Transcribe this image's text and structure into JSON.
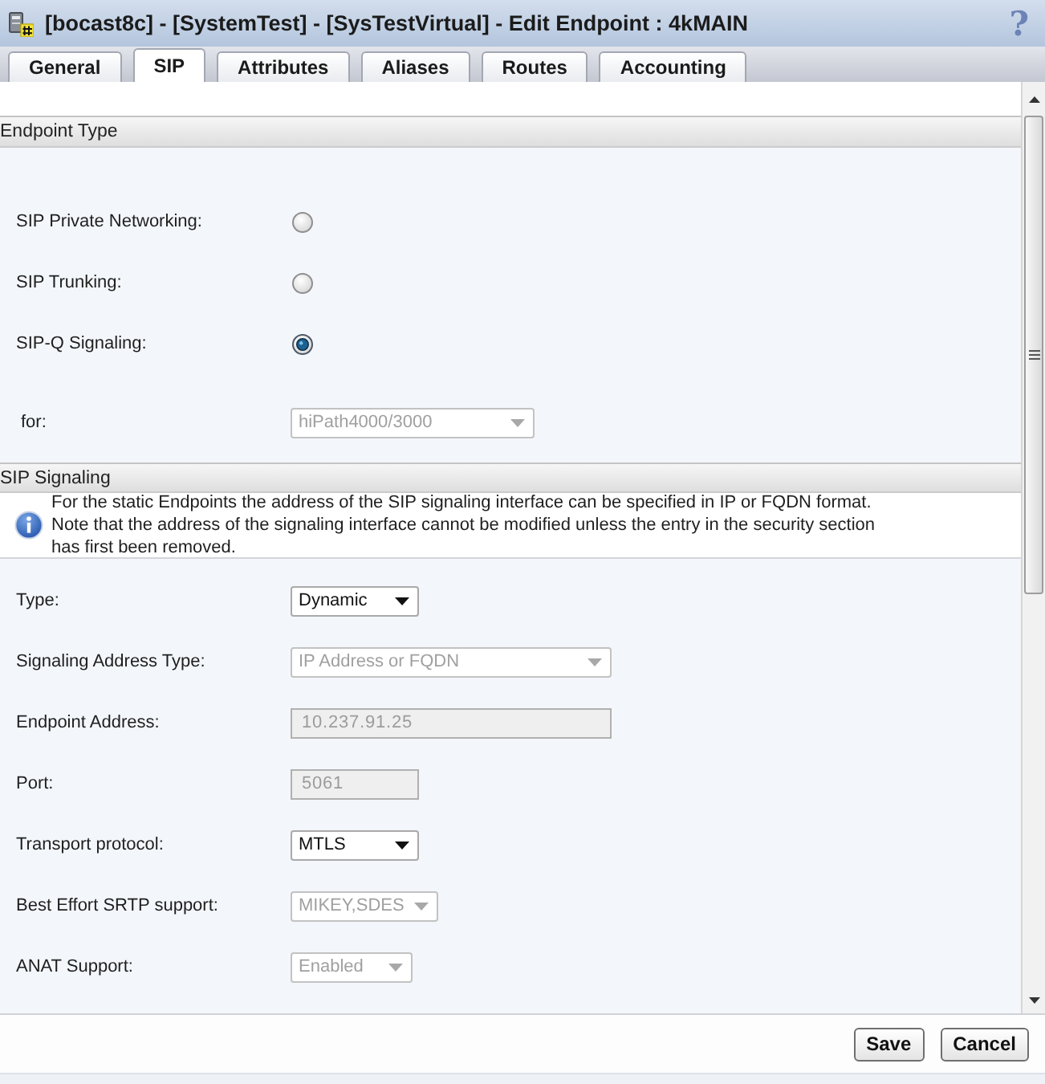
{
  "window": {
    "title": "[bocast8c] - [SystemTest] - [SysTestVirtual] - Edit Endpoint : 4kMAIN",
    "help": "?"
  },
  "tabs": [
    {
      "label": "General",
      "selected": false
    },
    {
      "label": "SIP",
      "selected": true
    },
    {
      "label": "Attributes",
      "selected": false
    },
    {
      "label": "Aliases",
      "selected": false
    },
    {
      "label": "Routes",
      "selected": false
    },
    {
      "label": "Accounting",
      "selected": false
    }
  ],
  "sections": [
    {
      "title": "Endpoint Type",
      "fields": [
        {
          "kind": "radio",
          "label": "SIP Private Networking:",
          "checked": false
        },
        {
          "kind": "radio",
          "label": "SIP Trunking:",
          "checked": false
        },
        {
          "kind": "radio",
          "label": "SIP-Q Signaling:",
          "checked": true
        },
        {
          "kind": "select",
          "label": "for:",
          "value": "hiPath4000/3000",
          "disabled": true
        }
      ]
    },
    {
      "title": "SIP Signaling",
      "note_lines": [
        "For the static Endpoints the address of the SIP signaling interface can be specified in IP or FQDN format.",
        "Note that the address of the signaling interface cannot be modified unless the entry in the security section",
        "has first been removed."
      ],
      "fields": [
        {
          "kind": "select",
          "label": "Type:",
          "value": "Dynamic",
          "disabled": false
        },
        {
          "kind": "select",
          "label": "Signaling Address Type:",
          "value": "IP Address or FQDN",
          "disabled": true
        },
        {
          "kind": "input",
          "label": "Endpoint Address:",
          "value": "10.237.91.25",
          "disabled": true
        },
        {
          "kind": "input",
          "label": "Port:",
          "value": "5061",
          "disabled": true
        },
        {
          "kind": "select",
          "label": "Transport protocol:",
          "value": "MTLS",
          "disabled": false
        },
        {
          "kind": "select",
          "label": "Best Effort SRTP support:",
          "value": "MIKEY,SDES",
          "disabled": true
        },
        {
          "kind": "select",
          "label": "ANAT Support:",
          "value": "Enabled",
          "disabled": true
        }
      ]
    }
  ],
  "buttons": [
    {
      "label": "Save"
    },
    {
      "label": "Cancel"
    }
  ]
}
